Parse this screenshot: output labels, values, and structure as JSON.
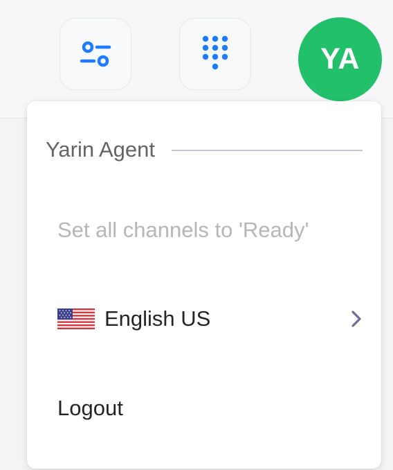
{
  "header": {
    "avatar_initials": "YA",
    "colors": {
      "avatar_bg": "#22c06b",
      "icon_blue": "#1e7bff"
    },
    "icons": [
      "filter-settings-icon",
      "dialpad-icon"
    ]
  },
  "menu": {
    "agent_name": "Yarin Agent",
    "set_ready_label": "Set all channels to 'Ready'",
    "language_label": "English US",
    "language_flag": "us-flag-icon",
    "logout_label": "Logout"
  }
}
